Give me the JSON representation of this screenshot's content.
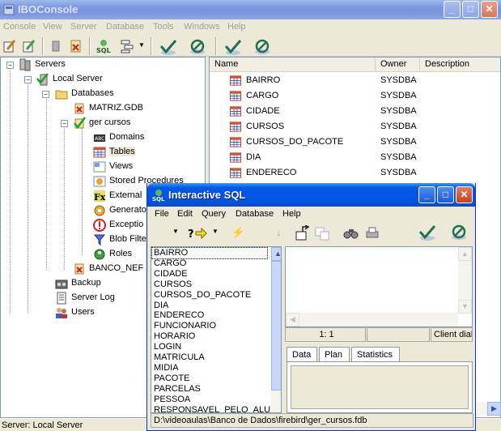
{
  "main": {
    "title": "IBOConsole",
    "menu": [
      "Console",
      "View",
      "Server",
      "Database",
      "Tools",
      "Windows",
      "Help"
    ],
    "tree": {
      "servers": "Servers",
      "local_server": "Local Server",
      "databases": "Databases",
      "matriz": "MATRIZ.GDB",
      "ger_cursos": "ger cursos",
      "domains": "Domains",
      "tables": "Tables",
      "views": "Views",
      "stored_procedures": "Stored Procedures",
      "external_functions": "External",
      "generators": "Generato",
      "exceptions": "Exceptio",
      "blob_filters": "Blob Filte",
      "roles": "Roles",
      "banco_nef": "BANCO_NEF",
      "backup": "Backup",
      "server_log": "Server Log",
      "users": "Users"
    },
    "list": {
      "columns": [
        "Name",
        "Owner",
        "Description"
      ],
      "rows": [
        {
          "name": "BAIRRO",
          "owner": "SYSDBA"
        },
        {
          "name": "CARGO",
          "owner": "SYSDBA"
        },
        {
          "name": "CIDADE",
          "owner": "SYSDBA"
        },
        {
          "name": "CURSOS",
          "owner": "SYSDBA"
        },
        {
          "name": "CURSOS_DO_PACOTE",
          "owner": "SYSDBA"
        },
        {
          "name": "DIA",
          "owner": "SYSDBA"
        },
        {
          "name": "ENDERECO",
          "owner": "SYSDBA"
        }
      ]
    },
    "status": "Server: Local Server"
  },
  "isql": {
    "title": "Interactive SQL",
    "menu": [
      "File",
      "Edit",
      "Query",
      "Database",
      "Help"
    ],
    "tables": [
      "BAIRRO",
      "CARGO",
      "CIDADE",
      "CURSOS",
      "CURSOS_DO_PACOTE",
      "DIA",
      "ENDERECO",
      "FUNCIONARIO",
      "HORARIO",
      "LOGIN",
      "MATRICULA",
      "MIDIA",
      "PACOTE",
      "PARCELAS",
      "PESSOA",
      "RESPONSAVEL_PELO_ALU"
    ],
    "cursor_pos": "1: 1",
    "dialect": "Client diale",
    "tabs": [
      "Data",
      "Plan",
      "Statistics"
    ],
    "status_path": "D:\\videoaulas\\Banco de Dados\\firebird\\ger_cursos.fdb"
  },
  "colors": {
    "active_title": "#0055E5",
    "inactive_title": "#7A96DF",
    "face": "#ECE9D8"
  }
}
